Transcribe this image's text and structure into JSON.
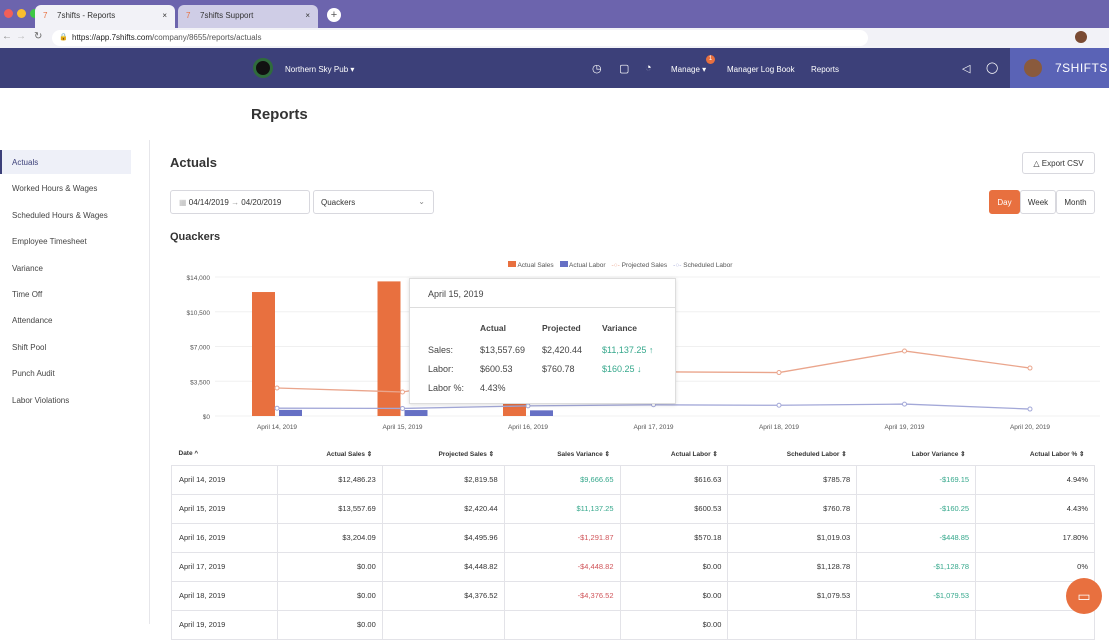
{
  "browser": {
    "tabs": [
      {
        "label": "7shifts - Reports"
      },
      {
        "label": "7shifts Support"
      }
    ],
    "url_host": "https://app.7shifts.com",
    "url_path": "/company/8655/reports/actuals"
  },
  "header": {
    "location": "Northern Sky Pub",
    "manage": "Manage",
    "manage_badge": "1",
    "log_book": "Manager Log Book",
    "reports": "Reports",
    "brand": "7SHIFTS"
  },
  "page": {
    "title": "Reports",
    "section": "Actuals",
    "export": "Export CSV",
    "date_from": "04/14/2019",
    "date_to": "04/20/2019",
    "location_select": "Quackers",
    "chart_title": "Quackers",
    "periods": [
      "Day",
      "Week",
      "Month"
    ],
    "active_period": "Day"
  },
  "sidebar": {
    "items": [
      {
        "label": "Actuals"
      },
      {
        "label": "Worked Hours & Wages"
      },
      {
        "label": "Scheduled Hours & Wages"
      },
      {
        "label": "Employee Timesheet"
      },
      {
        "label": "Variance"
      },
      {
        "label": "Time Off"
      },
      {
        "label": "Attendance"
      },
      {
        "label": "Shift Pool"
      },
      {
        "label": "Punch Audit"
      },
      {
        "label": "Labor Violations"
      }
    ]
  },
  "colors": {
    "actual_sales": "#e8703f",
    "actual_labor": "#6670c4",
    "projected_sales": "#eaa58c",
    "scheduled_labor": "#a3a8d8",
    "positive": "#36a88c",
    "negative": "#d0555a"
  },
  "chart_data": {
    "type": "bar",
    "categories": [
      "April 14, 2019",
      "April 15, 2019",
      "April 16, 2019",
      "April 17, 2019",
      "April 18, 2019",
      "April 19, 2019",
      "April 20, 2019"
    ],
    "y_ticks": [
      "$0",
      "$3,500",
      "$7,000",
      "$10,500",
      "$14,000"
    ],
    "ylim": [
      0,
      14000
    ],
    "legend": "top-right",
    "series": [
      {
        "name": "Actual Sales",
        "kind": "bar",
        "values": [
          12486.23,
          13557.69,
          3204.09,
          0,
          0,
          0,
          0
        ]
      },
      {
        "name": "Actual Labor",
        "kind": "bar",
        "values": [
          616.63,
          600.53,
          570.18,
          0,
          0,
          0,
          0
        ]
      },
      {
        "name": "Projected Sales",
        "kind": "line",
        "values": [
          2819.58,
          2420.44,
          4495.96,
          4448.82,
          4376.52,
          6550,
          4830
        ]
      },
      {
        "name": "Scheduled Labor",
        "kind": "line",
        "values": [
          785.78,
          760.78,
          1019.03,
          1128.78,
          1079.53,
          1200,
          700
        ]
      }
    ]
  },
  "tooltip": {
    "date": "April 15, 2019",
    "cols": [
      "Actual",
      "Projected",
      "Variance"
    ],
    "rows": [
      {
        "label": "Sales:",
        "actual": "$13,557.69",
        "projected": "$2,420.44",
        "variance": "$11,137.25 ↑"
      },
      {
        "label": "Labor:",
        "actual": "$600.53",
        "projected": "$760.78",
        "variance": "$160.25 ↓"
      },
      {
        "label": "Labor %:",
        "actual": "4.43%",
        "projected": "",
        "variance": ""
      }
    ]
  },
  "table": {
    "headers": [
      "Date ^",
      "Actual Sales ⇕",
      "Projected Sales ⇕",
      "Sales Variance ⇕",
      "Actual Labor ⇕",
      "Scheduled Labor ⇕",
      "Labor Variance ⇕",
      "Actual Labor % ⇕"
    ],
    "rows": [
      [
        "April 14, 2019",
        "$12,486.23",
        "$2,819.58",
        "$9,666.65",
        "$616.63",
        "$785.78",
        "-$169.15",
        "4.94%"
      ],
      [
        "April 15, 2019",
        "$13,557.69",
        "$2,420.44",
        "$11,137.25",
        "$600.53",
        "$760.78",
        "-$160.25",
        "4.43%"
      ],
      [
        "April 16, 2019",
        "$3,204.09",
        "$4,495.96",
        "-$1,291.87",
        "$570.18",
        "$1,019.03",
        "-$448.85",
        "17.80%"
      ],
      [
        "April 17, 2019",
        "$0.00",
        "$4,448.82",
        "-$4,448.82",
        "$0.00",
        "$1,128.78",
        "-$1,128.78",
        "0%"
      ],
      [
        "April 18, 2019",
        "$0.00",
        "$4,376.52",
        "-$4,376.52",
        "$0.00",
        "$1,079.53",
        "-$1,079.53",
        "0%"
      ],
      [
        "April 19, 2019",
        "$0.00",
        "",
        "",
        "$0.00",
        "",
        "",
        ""
      ]
    ]
  }
}
